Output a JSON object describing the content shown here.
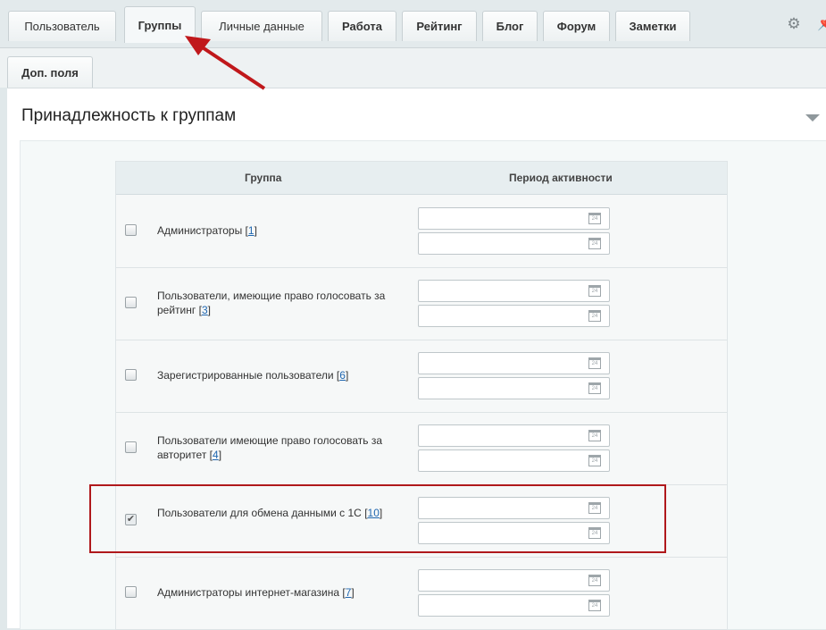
{
  "tabs": [
    {
      "label": "Пользователь"
    },
    {
      "label": "Группы"
    },
    {
      "label": "Личные данные"
    },
    {
      "label": "Работа"
    },
    {
      "label": "Рейтинг"
    },
    {
      "label": "Блог"
    },
    {
      "label": "Форум"
    },
    {
      "label": "Заметки"
    }
  ],
  "tabs_row2": [
    {
      "label": "Доп. поля"
    }
  ],
  "toolbar": {
    "gear_icon": "gear-icon",
    "pin_icon": "pin-icon"
  },
  "section": {
    "title": "Принадлежность к группам"
  },
  "table": {
    "headers": [
      "Группа",
      "Период активности"
    ],
    "calendar_icon_text": "24",
    "rows": [
      {
        "name": "Администраторы",
        "id": "1",
        "checked": false
      },
      {
        "name": "Пользователи, имеющие право голосовать за рейтинг",
        "id": "3",
        "checked": false
      },
      {
        "name": "Зарегистрированные пользователи",
        "id": "6",
        "checked": false
      },
      {
        "name": "Пользователи имеющие право голосовать за авторитет",
        "id": "4",
        "checked": false
      },
      {
        "name": "Пользователи для обмена данными с 1С",
        "id": "10",
        "checked": true
      },
      {
        "name": "Администраторы интернет-магазина",
        "id": "7",
        "checked": false
      }
    ]
  },
  "colors": {
    "annotation": "#b0191c",
    "link": "#2067b0"
  }
}
